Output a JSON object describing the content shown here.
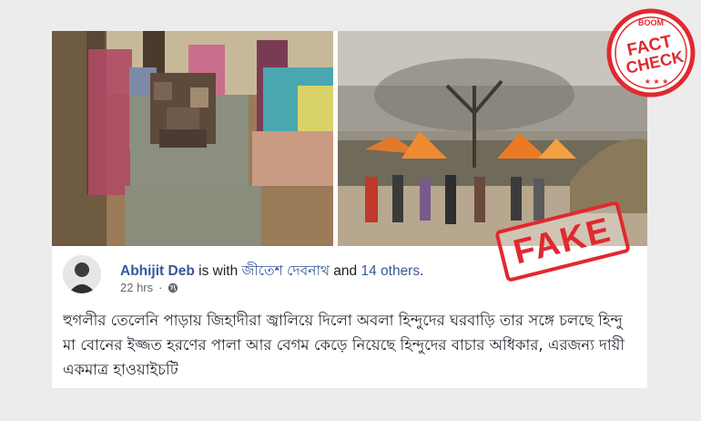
{
  "post": {
    "author_name": "Abhijit Deb",
    "with_text": " is with ",
    "tagged_name": "জীতেশ দেবনাথ",
    "and_text": " and ",
    "others_text": "14 others",
    "period": ".",
    "time": "22 hrs",
    "separator": "·",
    "privacy_icon": "globe-icon",
    "body_text": "হুগলীর তেলেনি পাড়ায় জিহাদীরা জ্বালিয়ে দিলো অবলা হিন্দুদের ঘরবাড়ি তার সঙ্গে চলছে হিন্দু মা বোনের ইজ্জত হরণের পালা আর বেগম কেড়ে নিয়েছে হিন্দুদের বাচার অধিকার, এরজন্য দায়ী একমাত্র হাওয়াইচটি"
  },
  "badge": {
    "top_text": "BOOM",
    "line1": "FACT",
    "line2": "CHECK",
    "stars": "★ ★ ★"
  },
  "stamp": {
    "label": "FAKE"
  },
  "colors": {
    "link": "#365899",
    "text": "#1d2129",
    "meta": "#616770",
    "brand_red": "#e0292f"
  }
}
